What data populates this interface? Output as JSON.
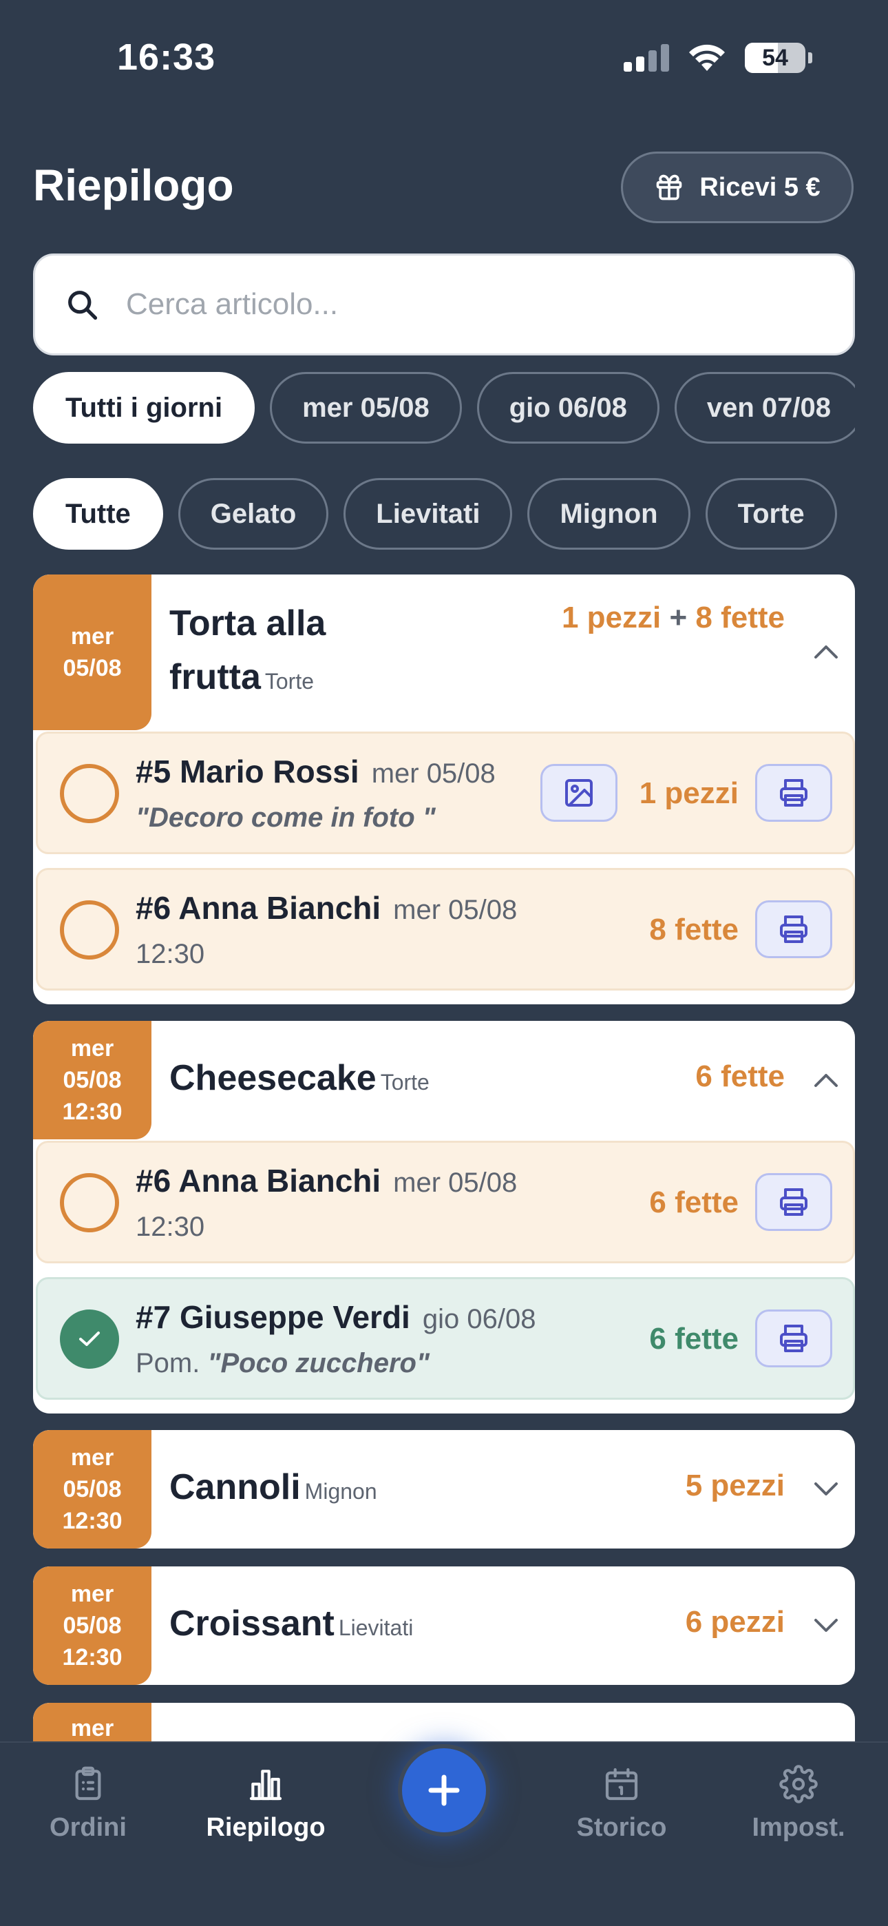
{
  "status_bar": {
    "time": "16:33",
    "battery": "54",
    "battery_level": 0.54
  },
  "header": {
    "title": "Riepilogo",
    "gift_button": "Ricevi 5 €"
  },
  "search": {
    "placeholder": "Cerca articolo..."
  },
  "day_filters": [
    "Tutti i giorni",
    "mer 05/08",
    "gio 06/08",
    "ven 07/08"
  ],
  "category_filters": [
    "Tutte",
    "Gelato",
    "Lievitati",
    "Mignon",
    "Torte"
  ],
  "cards": [
    {
      "date_line1": "mer",
      "date_line2": "05/08",
      "date_line3": "",
      "title_line1": "Torta alla",
      "title_line2": "frutta",
      "category": "Torte",
      "qty_a": "1 pezzi",
      "qty_plus": "+",
      "qty_b": "8 fette",
      "expanded": true,
      "orders": [
        {
          "name": "#5 Mario Rossi",
          "date": "mer 05/08",
          "note": "\"Decoro come in foto \"",
          "qty": "1 pezzi",
          "status": "pending"
        },
        {
          "name": "#6 Anna Bianchi",
          "date": "mer 05/08",
          "time": "12:30",
          "qty": "8 fette",
          "status": "pending"
        }
      ]
    },
    {
      "date_line1": "mer",
      "date_line2": "05/08",
      "date_line3": "12:30",
      "title": "Cheesecake",
      "category": "Torte",
      "qty": "6 fette",
      "expanded": true,
      "orders": [
        {
          "name": "#6 Anna Bianchi",
          "date": "mer 05/08",
          "time": "12:30",
          "qty": "6 fette",
          "status": "pending"
        },
        {
          "name": "#7 Giuseppe Verdi",
          "date": "gio 06/08",
          "prefix": "Pom.",
          "note": "\"Poco zucchero\"",
          "qty": "6 fette",
          "status": "done"
        }
      ]
    },
    {
      "date_line1": "mer",
      "date_line2": "05/08",
      "date_line3": "12:30",
      "title": "Cannoli",
      "category": "Mignon",
      "qty": "5 pezzi",
      "expanded": false
    },
    {
      "date_line1": "mer",
      "date_line2": "05/08",
      "date_line3": "12:30",
      "title": "Croissant",
      "category": "Lievitati",
      "qty": "6 pezzi",
      "expanded": false
    },
    {
      "date_line1": "mer"
    }
  ],
  "bottom_nav": [
    {
      "label": "Ordini",
      "icon": "clipboard-icon"
    },
    {
      "label": "Riepilogo",
      "icon": "bar-chart-icon",
      "active": true
    },
    {
      "label": "Storico",
      "icon": "calendar-icon"
    },
    {
      "label": "Impost.",
      "icon": "gear-icon"
    }
  ],
  "colors": {
    "background": "#2f3b4c",
    "accent": "#d9873a",
    "success": "#3f8a6b",
    "primary": "#2e66d6"
  }
}
